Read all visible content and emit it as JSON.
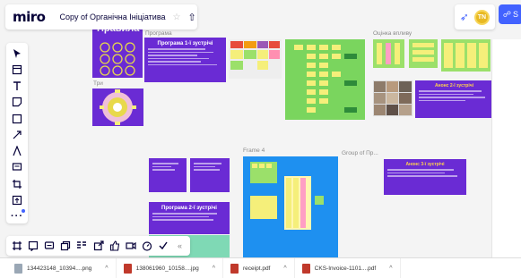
{
  "app": {
    "logo": "miro",
    "board_title": "Copy of Органічна Ініціатива",
    "star_icon": "star-icon",
    "upload_icon": "upload-icon"
  },
  "header_right": {
    "avatar_initials": "TN",
    "share_label": "S"
  },
  "board": {
    "frame_labels": [
      "Правила",
      "Програма",
      "Оцінка впливу",
      "Три",
      "Frame 4",
      "Group of Пр..."
    ],
    "programs": {
      "p1": "Програма 1-ї зустрічі",
      "p2": "Програма 2-ї зустрічі",
      "a2": "Анонс 2-ї зустрічі",
      "a3": "Анонс 3-ї зустрічі"
    }
  },
  "left_toolbar": [
    "cursor-icon",
    "frame-icon",
    "text-icon",
    "sticky-note-icon",
    "shape-icon",
    "pen-icon",
    "line-icon",
    "comment-icon",
    "crop-icon",
    "upload-icon",
    "more-icon"
  ],
  "bottom_toolbar": [
    "grid-icon",
    "comment-icon",
    "chat-icon",
    "card-icon",
    "kanban-icon",
    "share-icon",
    "like-icon",
    "video-icon",
    "timer-icon",
    "vote-icon",
    "collapse-icon"
  ],
  "downloads": [
    {
      "name": "134423148_10394....png",
      "color": "#9aa7b5"
    },
    {
      "name": "138061960_10158....jpg",
      "color": "#c0392b"
    },
    {
      "name": "receipt.pdf",
      "color": "#c0392b"
    },
    {
      "name": "CKS-Invoice-1101....pdf",
      "color": "#c0392b"
    }
  ],
  "colors": {
    "accent": "#4262ff",
    "purple": "#6a2bd4",
    "sticky_yellow": "#f5ef7a",
    "sticky_green": "#9be06a",
    "grid_green": "#7ad55e"
  }
}
